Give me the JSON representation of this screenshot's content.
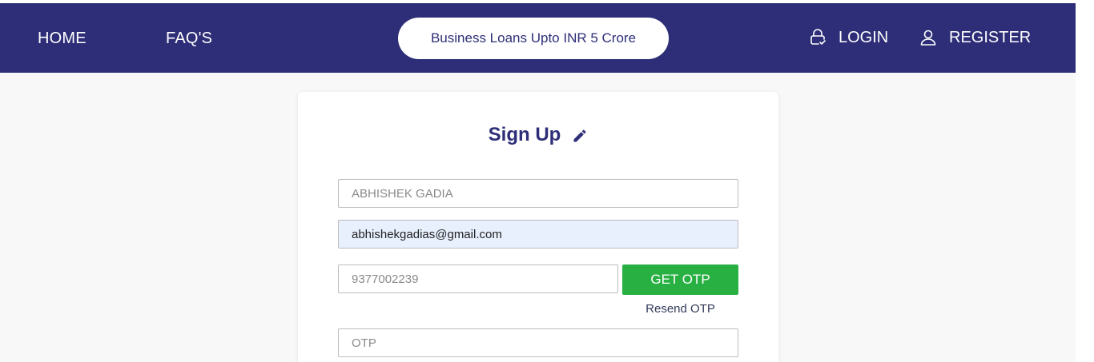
{
  "nav": {
    "home": "HOME",
    "faqs": "FAQ'S",
    "promo": "Business Loans Upto INR 5 Crore",
    "login": "LOGIN",
    "register": "REGISTER"
  },
  "form": {
    "title": "Sign Up",
    "name_placeholder": "ABHISHEK GADIA",
    "email_value": "abhishekgadias@gmail.com",
    "phone_placeholder": "9377002239",
    "get_otp": "GET OTP",
    "resend_otp": "Resend OTP",
    "otp_placeholder": "OTP"
  },
  "colors": {
    "navbar": "#2e2e78",
    "accent_green": "#28b043",
    "autofill": "#e8f0fe"
  },
  "icons": {
    "login": "lock-check-icon",
    "register": "user-icon",
    "title": "pencil-icon"
  }
}
